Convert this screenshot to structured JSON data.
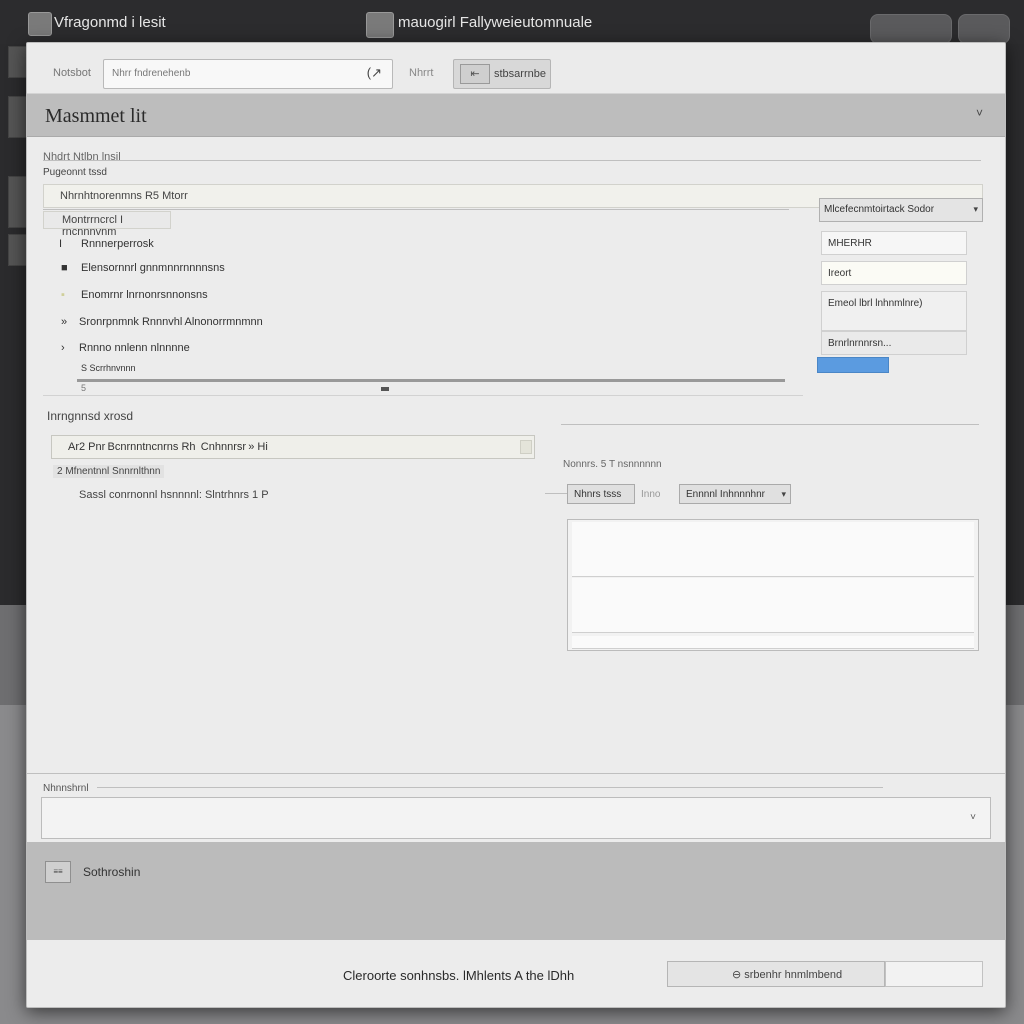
{
  "app": {
    "left_title": "Vfragonmd i lesit",
    "center_title": "mauogirl Fallyweieutomnuale"
  },
  "toolbar": {
    "label": "Notsbot",
    "search_text": "Nhrr fndrenehenb",
    "search_icon": "(↗",
    "filter_label": "Nhrrt",
    "action_label": "stbsarrnbe",
    "action_icon": "⇤"
  },
  "header": {
    "title": "Masmmet lit",
    "chevron": "˅"
  },
  "main": {
    "section_label": "Nhdrt Ntlbn lnsil",
    "field_label": "Pugeonnt tssd",
    "row_text": "Nhrnhtnorenmns R5 Mtorr",
    "subrow_text": "Montrrncrcl  I rncnnnvnm",
    "tree": [
      {
        "marker": "I",
        "label": "Rnnnerperrosk"
      },
      {
        "marker": "■",
        "label": "Elensornnrl gnnmnnrnnnnsns"
      },
      {
        "marker": "▪",
        "label": "Enomrnr lnrnonrsnnonsns"
      },
      {
        "marker": "»",
        "label": "Sronrpnmnk Rnnnvhl Alnonorrmnmnn"
      },
      {
        "marker": "›",
        "label": "Rnnno nnlenn nlnnnne"
      },
      {
        "marker": "",
        "label": "S Scrrhnvnnn"
      }
    ],
    "slider_label": "5",
    "slider_value": 0.43
  },
  "panel": {
    "select_label": "Mlcefecnmtoirtack Sodor",
    "fields": [
      "MHERHR",
      "Ireort",
      "Emeol lbrl lnhnmlnre)",
      "Brnrlnrnnrsn..."
    ]
  },
  "second": {
    "label": "Inrngnnsd xrosd",
    "input_text": "Ar2 Pnr Bcnrnntncnrns Rh  Cnhnnrsr » Hi",
    "line2": "2 Mfnentnnl Snnrnlthnn",
    "line3": "Sassl conrnonnl hsnnnnl: Slntrhnrs 1 P"
  },
  "right_section": {
    "label": "Nonnrs. 5 T nsnnnnnn",
    "dropdown1": "Nhnrs tsss",
    "mid_text": "Inno",
    "dropdown2": "Ennnnl Inhnnnhnr"
  },
  "footer": {
    "section_label": "Nhnnshrnl",
    "input_arrow": "˅",
    "status_icon_text": "≡≡",
    "status_text": "Sothroshin",
    "bottom_message": "Cleroorte sonhnsbs. lMhlents A the lDhh",
    "bottom_button": "⊖ srbenhr hnmlmbend"
  }
}
